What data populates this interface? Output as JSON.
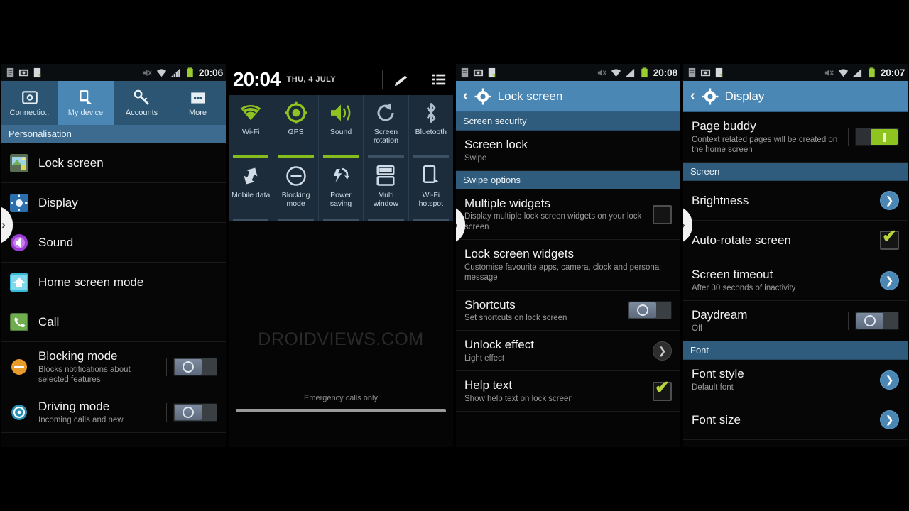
{
  "watermark": "DROIDVIEWS.COM",
  "colors": {
    "accent_blue": "#4a87b4",
    "header_blue": "#3d6b8f",
    "green": "#8fc31f",
    "battery_green": "#9acd32"
  },
  "panel1": {
    "statusbar": {
      "time": "20:06",
      "icons": [
        "document-icon",
        "screenshot-icon",
        "file-icon",
        "mute-icon",
        "wifi-icon",
        "signal-icon",
        "battery-icon"
      ]
    },
    "tabs": [
      {
        "label": "Connectio..",
        "icon": "connections-icon",
        "selected": false
      },
      {
        "label": "My device",
        "icon": "my-device-icon",
        "selected": true
      },
      {
        "label": "Accounts",
        "icon": "accounts-key-icon",
        "selected": false
      },
      {
        "label": "More",
        "icon": "more-dots-icon",
        "selected": false
      }
    ],
    "section": "Personalisation",
    "items": [
      {
        "title": "Lock screen",
        "sub": "",
        "icon": "lock-screen-icon",
        "control": "none"
      },
      {
        "title": "Display",
        "sub": "",
        "icon": "display-icon",
        "control": "none"
      },
      {
        "title": "Sound",
        "sub": "",
        "icon": "sound-icon",
        "control": "none"
      },
      {
        "title": "Home screen mode",
        "sub": "",
        "icon": "home-screen-icon",
        "control": "none"
      },
      {
        "title": "Call",
        "sub": "",
        "icon": "call-icon",
        "control": "none"
      },
      {
        "title": "Blocking mode",
        "sub": "Blocks notifications about selected features",
        "icon": "blocking-mode-icon",
        "control": "switch-off"
      },
      {
        "title": "Driving mode",
        "sub": "Incoming calls and new",
        "icon": "driving-mode-icon",
        "control": "switch-off"
      }
    ]
  },
  "panel2": {
    "clock": "20:04",
    "date": "THU, 4 JULY",
    "actions": [
      "edit-icon",
      "list-icon"
    ],
    "quick_settings": [
      {
        "label": "Wi-Fi",
        "icon": "wifi-icon",
        "active": true
      },
      {
        "label": "GPS",
        "icon": "gps-icon",
        "active": true
      },
      {
        "label": "Sound",
        "icon": "sound-icon",
        "active": true
      },
      {
        "label": "Screen rotation",
        "icon": "screen-rotation-icon",
        "active": false
      },
      {
        "label": "Bluetooth",
        "icon": "bluetooth-icon",
        "active": false
      },
      {
        "label": "Mobile data",
        "icon": "mobile-data-icon",
        "active": false
      },
      {
        "label": "Blocking mode",
        "icon": "blocking-mode-icon",
        "active": false
      },
      {
        "label": "Power saving",
        "icon": "power-saving-icon",
        "active": false
      },
      {
        "label": "Multi window",
        "icon": "multi-window-icon",
        "active": false
      },
      {
        "label": "Wi-Fi hotspot",
        "icon": "wifi-hotspot-icon",
        "active": false
      }
    ],
    "emergency": "Emergency calls only"
  },
  "panel3": {
    "statusbar": {
      "time": "20:08"
    },
    "title": "Lock screen",
    "sections": [
      {
        "header": "Screen security"
      },
      {
        "header": "Swipe options"
      }
    ],
    "items": [
      {
        "title": "Screen lock",
        "sub": "Swipe",
        "control": "none"
      },
      {
        "title": "Multiple widgets",
        "sub": "Display multiple lock screen widgets on your lock screen",
        "control": "checkbox-off"
      },
      {
        "title": "Lock screen widgets",
        "sub": "Customise favourite apps, camera, clock and personal message",
        "control": "none"
      },
      {
        "title": "Shortcuts",
        "sub": "Set shortcuts on lock screen",
        "control": "switch-off"
      },
      {
        "title": "Unlock effect",
        "sub": "Light effect",
        "control": "chevron"
      },
      {
        "title": "Help text",
        "sub": "Show help text on lock screen",
        "control": "checkbox-on"
      }
    ]
  },
  "panel4": {
    "statusbar": {
      "time": "20:07"
    },
    "title": "Display",
    "items": [
      {
        "title": "Page buddy",
        "sub": "Context related pages will be created on the home screen",
        "control": "switch-on"
      },
      {
        "header": "Screen"
      },
      {
        "title": "Brightness",
        "sub": "",
        "control": "chevron-blue"
      },
      {
        "title": "Auto-rotate screen",
        "sub": "",
        "control": "checkbox-on"
      },
      {
        "title": "Screen timeout",
        "sub": "After 30 seconds of inactivity",
        "control": "chevron-blue"
      },
      {
        "title": "Daydream",
        "sub": "Off",
        "control": "switch-off"
      },
      {
        "header": "Font"
      },
      {
        "title": "Font style",
        "sub": "Default font",
        "control": "chevron-blue"
      },
      {
        "title": "Font size",
        "sub": "",
        "control": "chevron-blue"
      }
    ]
  }
}
